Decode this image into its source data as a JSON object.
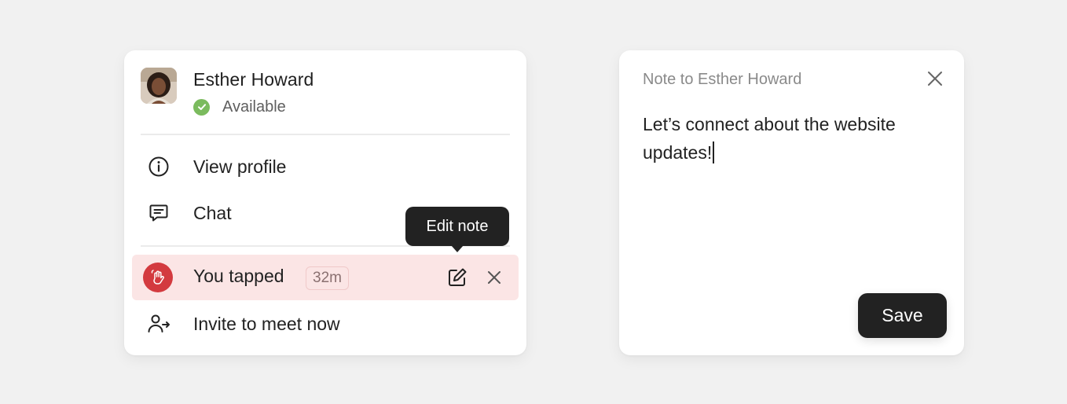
{
  "profile": {
    "name": "Esther Howard",
    "status": "Available",
    "status_color": "#7bbb5e"
  },
  "menu": {
    "view_profile": "View profile",
    "chat": "Chat",
    "invite": "Invite to meet now"
  },
  "tap": {
    "label": "You tapped",
    "time": "32m",
    "badge_color": "#d33a3f",
    "row_bg": "#fbe5e5"
  },
  "tooltip": {
    "text": "Edit note"
  },
  "note": {
    "title": "Note to Esther Howard",
    "body": "Let’s connect about the website updates!",
    "save_label": "Save"
  },
  "icons": [
    "info-icon",
    "chat-icon",
    "edit-icon",
    "close-icon",
    "person-arrow-icon",
    "check-icon",
    "wave-hand-icon"
  ]
}
